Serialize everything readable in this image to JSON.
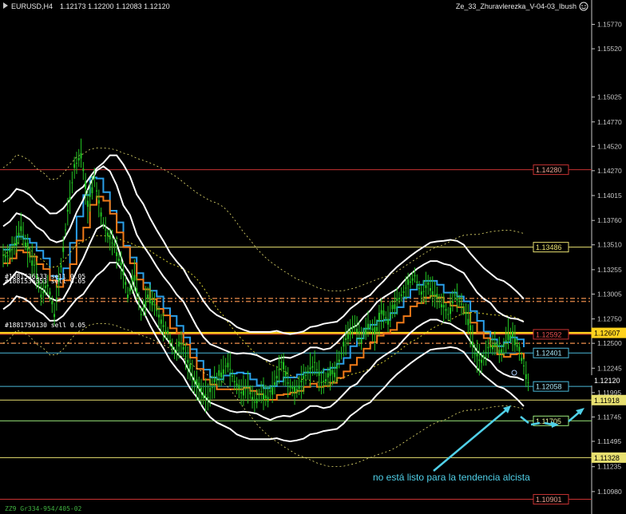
{
  "header": {
    "symbol": "EURUSD,H4",
    "ohlc": "1.12173 1.12200 1.12083 1.12120",
    "indicator": "Ze_33_Zhuravlerezka_V-04-03_Ibush",
    "smiley_icon": "smiley-icon"
  },
  "colors": {
    "background": "#000000",
    "axis": "#c8c8c8",
    "candles": "#22c522",
    "bands": "#ffffff",
    "ma_blue": "#2a9fe8",
    "ma_orange": "#f07a18",
    "ma_yellow_dots": "#d8d030",
    "line_red": "#c83232",
    "line_yellow": "#e8e070",
    "line_green": "#9ae87a",
    "line_cyan": "#4ab8d8",
    "annotation": "#50d0e8"
  },
  "chart_data": {
    "type": "candlestick",
    "title": "EURUSD,H4",
    "ylim": [
      1.1075,
      1.1602
    ],
    "y_ticks": [
      "1.15770",
      "1.15520",
      "1.15025",
      "1.14770",
      "1.14520",
      "1.14270",
      "1.14015",
      "1.13760",
      "1.13510",
      "1.13255",
      "1.13005",
      "1.12750",
      "1.12500",
      "1.12245",
      "1.11995",
      "1.11745",
      "1.11495",
      "1.11235",
      "1.10980"
    ],
    "close_path": [
      1.134,
      1.135,
      1.137,
      1.1345,
      1.133,
      1.13,
      1.131,
      1.128,
      1.133,
      1.1385,
      1.143,
      1.1445,
      1.139,
      1.142,
      1.138,
      1.136,
      1.135,
      1.133,
      1.13,
      1.132,
      1.128,
      1.13,
      1.129,
      1.127,
      1.126,
      1.124,
      1.125,
      1.123,
      1.121,
      1.12,
      1.1195,
      1.121,
      1.122,
      1.123,
      1.121,
      1.12,
      1.1205,
      1.119,
      1.12,
      1.1195,
      1.121,
      1.123,
      1.121,
      1.12,
      1.121,
      1.122,
      1.123,
      1.121,
      1.1215,
      1.122,
      1.124,
      1.126,
      1.127,
      1.1255,
      1.127,
      1.126,
      1.128,
      1.1275,
      1.129,
      1.13,
      1.131,
      1.132,
      1.13,
      1.131,
      1.13,
      1.129,
      1.128,
      1.13,
      1.129,
      1.1275,
      1.124,
      1.123,
      1.1245,
      1.125,
      1.124,
      1.126,
      1.1255,
      1.1235,
      1.121
    ],
    "price_lines": [
      {
        "label": "1.14280",
        "value": 1.1428,
        "color": "#c83232",
        "box": "#c83232",
        "text_color": "#e8a090"
      },
      {
        "label": "1.13486",
        "value": 1.13486,
        "color": "#e8e070",
        "box": "#e8e070",
        "text_color": "#e8e070"
      },
      {
        "label": "1.12607",
        "value": 1.12607,
        "color": "#ffd21e",
        "box": "#ffd21e",
        "text_color": "#000000",
        "filled": true
      },
      {
        "label": "1.12592",
        "value": 1.12592,
        "color": "#c83232",
        "box": "#c83232",
        "text_color": "#e85050",
        "filled": true
      },
      {
        "label": "1.12401",
        "value": 1.12401,
        "color": "#4ab8d8",
        "box": "#4ab8d8",
        "text_color": "#a8e8f8"
      },
      {
        "label": "1.12120",
        "value": 1.1212,
        "color": "none",
        "box": "#000000",
        "text_color": "#ffffff",
        "filled": true
      },
      {
        "label": "1.12058",
        "value": 1.12058,
        "color": "#4ab8d8",
        "box": "#4ab8d8",
        "text_color": "#a8e8f8"
      },
      {
        "label": "1.11918",
        "value": 1.11918,
        "color": "#e8e070",
        "box": "#e8e070",
        "text_color": "#000000",
        "filled": true
      },
      {
        "label": "1.11705",
        "value": 1.11705,
        "color": "#9ae87a",
        "box": "#9ae87a",
        "text_color": "#e8f8a0"
      },
      {
        "label": "1.11328",
        "value": 1.11328,
        "color": "#e8e070",
        "box": "#e8e070",
        "text_color": "#000000",
        "filled": true
      },
      {
        "label": "1.10901",
        "value": 1.10901,
        "color": "#c83232",
        "box": "#c83232",
        "text_color": "#e8a090"
      }
    ],
    "order_labels": [
      {
        "text": "#1881536133 sell 0.05"
      },
      {
        "text": "#1881536353 sell 0.05"
      },
      {
        "text": "#1881750130 sell 0.05"
      }
    ],
    "annotation": "no está listo para la tendencia alcista",
    "footer_label": "ZZ9 Gr334-954/405-02"
  }
}
